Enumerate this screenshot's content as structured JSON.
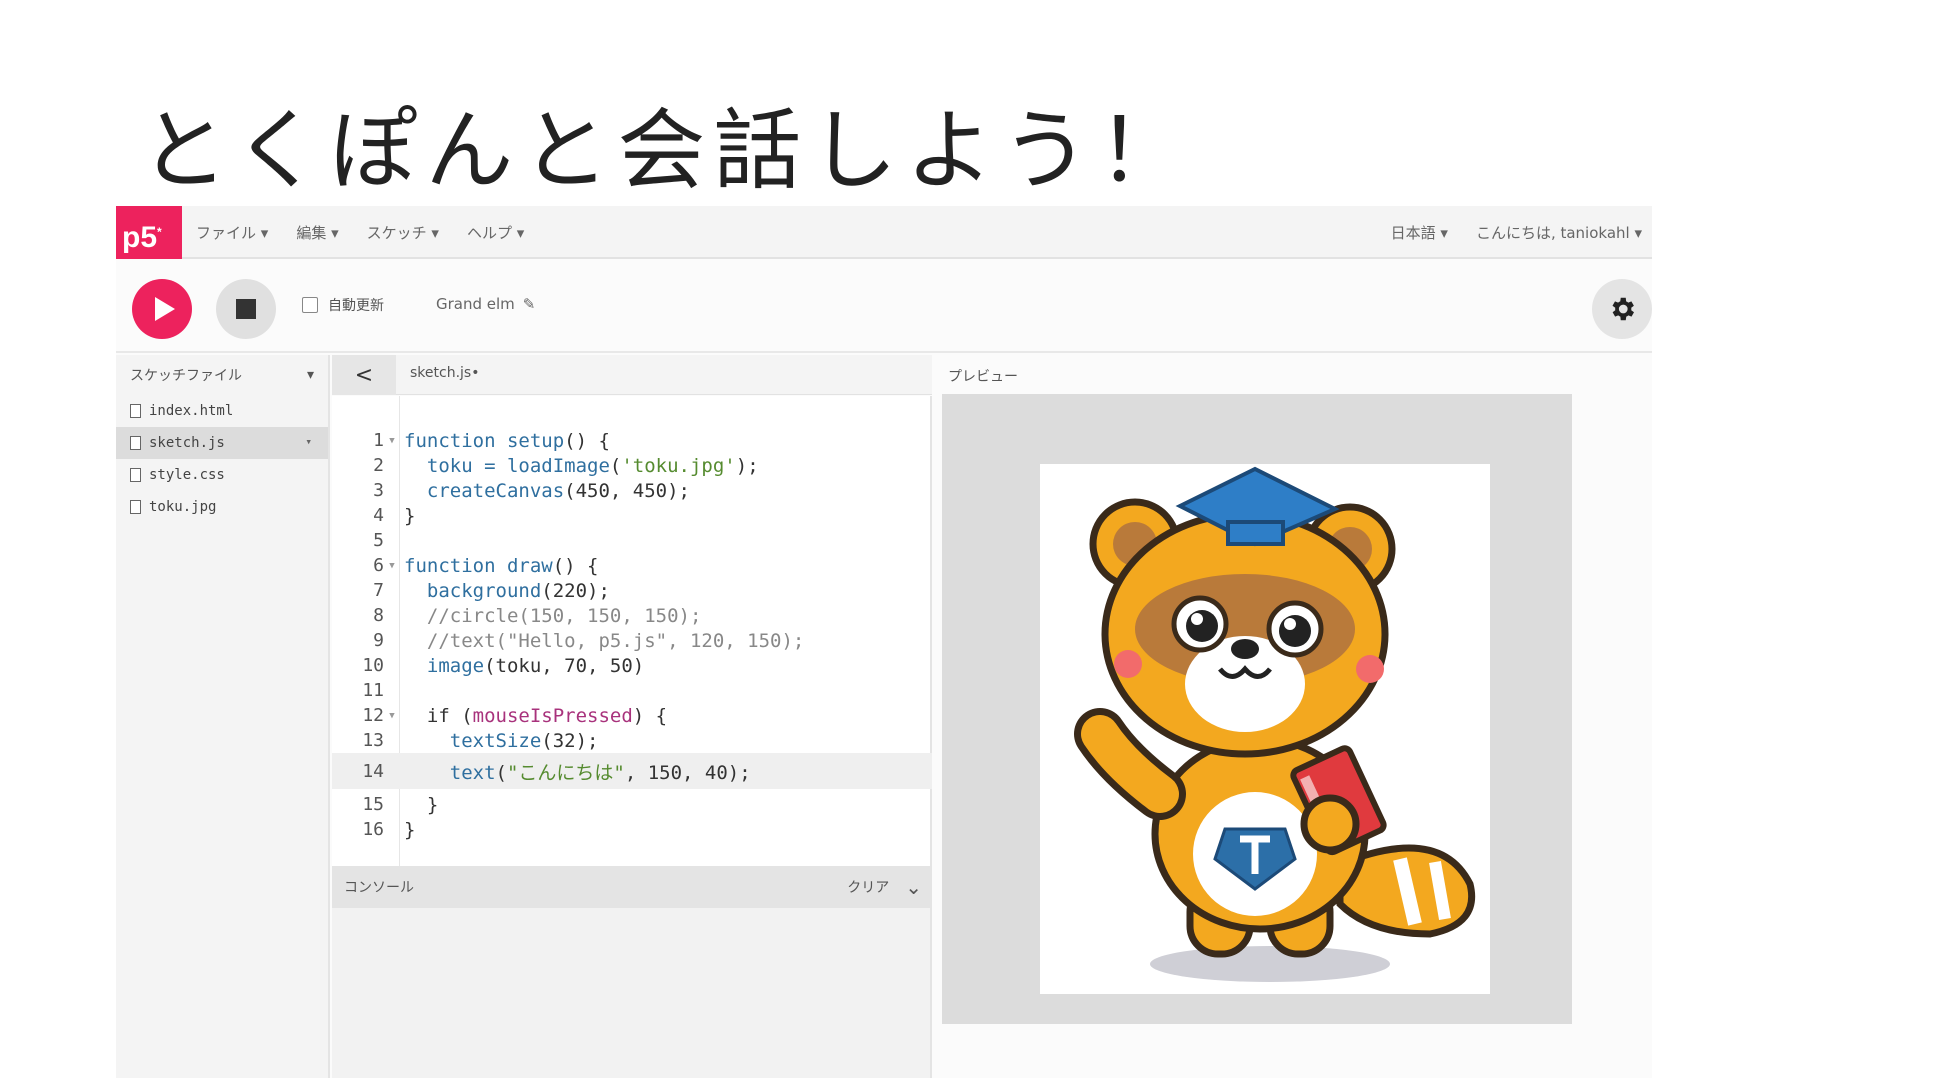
{
  "slide": {
    "title": "とくぽんと会話しよう！"
  },
  "nav": {
    "logo": "p5",
    "logo_mark": "*",
    "menu": [
      "ファイル ▾",
      "編集 ▾",
      "スケッチ ▾",
      "ヘルプ ▾"
    ],
    "language": "日本語 ▾",
    "user": "こんにちは, taniokahl ▾"
  },
  "toolbar": {
    "autorefresh_label": "自動更新",
    "sketch_name": "Grand elm",
    "edit_glyph": "✎"
  },
  "sidebar": {
    "header": "スケッチファイル",
    "header_caret": "▾",
    "files": [
      {
        "name": "index.html"
      },
      {
        "name": "sketch.js",
        "caret": "▾"
      },
      {
        "name": "style.css"
      },
      {
        "name": "toku.jpg"
      }
    ]
  },
  "editor": {
    "collapse_glyph": "<",
    "tab_name": "sketch.js•",
    "lines": [
      {
        "n": "1",
        "fold": "▼"
      },
      {
        "n": "2"
      },
      {
        "n": "3"
      },
      {
        "n": "4"
      },
      {
        "n": "5"
      },
      {
        "n": "6",
        "fold": "▼"
      },
      {
        "n": "7"
      },
      {
        "n": "8"
      },
      {
        "n": "9"
      },
      {
        "n": "10"
      },
      {
        "n": "11"
      },
      {
        "n": "12",
        "fold": "▼"
      },
      {
        "n": "13"
      },
      {
        "n": "14"
      },
      {
        "n": "15"
      },
      {
        "n": "16"
      }
    ],
    "code": {
      "l1a": "function",
      "l1b": " setup",
      "l1c": "() {",
      "l2a": "  toku = ",
      "l2b": "loadImage",
      "l2c": "(",
      "l2d": "'toku.jpg'",
      "l2e": ");",
      "l3a": "  createCanvas",
      "l3b": "(450, 450);",
      "l4": "}",
      "l5": "",
      "l6a": "function",
      "l6b": " draw",
      "l6c": "() {",
      "l7a": "  background",
      "l7b": "(220);",
      "l8": "  //circle(150, 150, 150);",
      "l9": "  //text(\"Hello, p5.js\", 120, 150);",
      "l10a": "  image",
      "l10b": "(toku, 70, 50)",
      "l11": "",
      "l12a": "  if (",
      "l12b": "mouseIsPressed",
      "l12c": ") {",
      "l13a": "    textSize",
      "l13b": "(32);",
      "l14a": "    text",
      "l14b": "(",
      "l14c": "\"こんにちは\"",
      "l14d": ", 150, 40);",
      "l15": "  }",
      "l16": "}"
    }
  },
  "console": {
    "label": "コンソール",
    "clear": "クリア",
    "chevron": "⌄"
  },
  "preview": {
    "label": "プレビュー"
  },
  "colors": {
    "accent": "#ed225d",
    "keyword": "#2f6f9f",
    "string": "#558b2f",
    "special": "#a8327c"
  }
}
